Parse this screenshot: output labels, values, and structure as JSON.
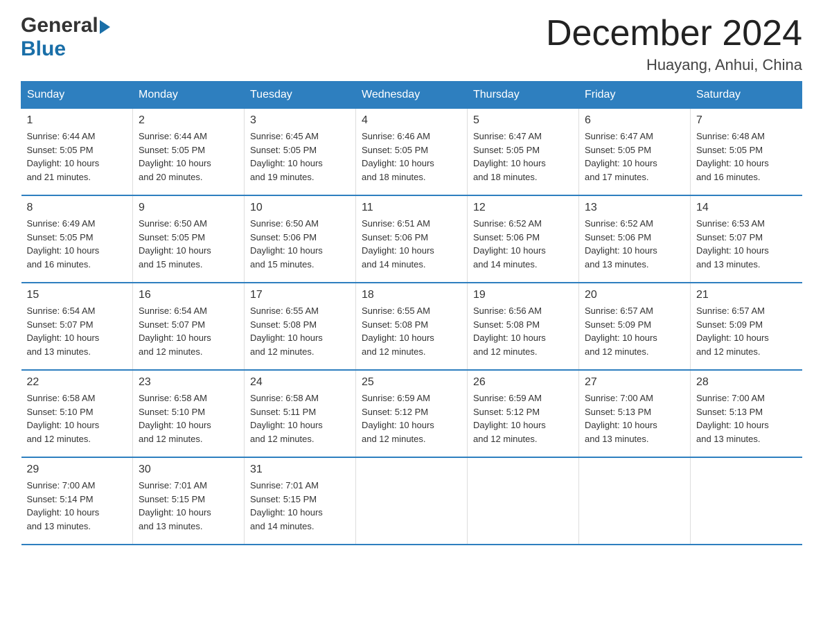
{
  "header": {
    "logo_general": "General",
    "logo_blue": "Blue",
    "month_title": "December 2024",
    "location": "Huayang, Anhui, China"
  },
  "weekdays": [
    "Sunday",
    "Monday",
    "Tuesday",
    "Wednesday",
    "Thursday",
    "Friday",
    "Saturday"
  ],
  "weeks": [
    [
      {
        "day": "1",
        "sunrise": "6:44 AM",
        "sunset": "5:05 PM",
        "daylight": "10 hours and 21 minutes."
      },
      {
        "day": "2",
        "sunrise": "6:44 AM",
        "sunset": "5:05 PM",
        "daylight": "10 hours and 20 minutes."
      },
      {
        "day": "3",
        "sunrise": "6:45 AM",
        "sunset": "5:05 PM",
        "daylight": "10 hours and 19 minutes."
      },
      {
        "day": "4",
        "sunrise": "6:46 AM",
        "sunset": "5:05 PM",
        "daylight": "10 hours and 18 minutes."
      },
      {
        "day": "5",
        "sunrise": "6:47 AM",
        "sunset": "5:05 PM",
        "daylight": "10 hours and 18 minutes."
      },
      {
        "day": "6",
        "sunrise": "6:47 AM",
        "sunset": "5:05 PM",
        "daylight": "10 hours and 17 minutes."
      },
      {
        "day": "7",
        "sunrise": "6:48 AM",
        "sunset": "5:05 PM",
        "daylight": "10 hours and 16 minutes."
      }
    ],
    [
      {
        "day": "8",
        "sunrise": "6:49 AM",
        "sunset": "5:05 PM",
        "daylight": "10 hours and 16 minutes."
      },
      {
        "day": "9",
        "sunrise": "6:50 AM",
        "sunset": "5:05 PM",
        "daylight": "10 hours and 15 minutes."
      },
      {
        "day": "10",
        "sunrise": "6:50 AM",
        "sunset": "5:06 PM",
        "daylight": "10 hours and 15 minutes."
      },
      {
        "day": "11",
        "sunrise": "6:51 AM",
        "sunset": "5:06 PM",
        "daylight": "10 hours and 14 minutes."
      },
      {
        "day": "12",
        "sunrise": "6:52 AM",
        "sunset": "5:06 PM",
        "daylight": "10 hours and 14 minutes."
      },
      {
        "day": "13",
        "sunrise": "6:52 AM",
        "sunset": "5:06 PM",
        "daylight": "10 hours and 13 minutes."
      },
      {
        "day": "14",
        "sunrise": "6:53 AM",
        "sunset": "5:07 PM",
        "daylight": "10 hours and 13 minutes."
      }
    ],
    [
      {
        "day": "15",
        "sunrise": "6:54 AM",
        "sunset": "5:07 PM",
        "daylight": "10 hours and 13 minutes."
      },
      {
        "day": "16",
        "sunrise": "6:54 AM",
        "sunset": "5:07 PM",
        "daylight": "10 hours and 12 minutes."
      },
      {
        "day": "17",
        "sunrise": "6:55 AM",
        "sunset": "5:08 PM",
        "daylight": "10 hours and 12 minutes."
      },
      {
        "day": "18",
        "sunrise": "6:55 AM",
        "sunset": "5:08 PM",
        "daylight": "10 hours and 12 minutes."
      },
      {
        "day": "19",
        "sunrise": "6:56 AM",
        "sunset": "5:08 PM",
        "daylight": "10 hours and 12 minutes."
      },
      {
        "day": "20",
        "sunrise": "6:57 AM",
        "sunset": "5:09 PM",
        "daylight": "10 hours and 12 minutes."
      },
      {
        "day": "21",
        "sunrise": "6:57 AM",
        "sunset": "5:09 PM",
        "daylight": "10 hours and 12 minutes."
      }
    ],
    [
      {
        "day": "22",
        "sunrise": "6:58 AM",
        "sunset": "5:10 PM",
        "daylight": "10 hours and 12 minutes."
      },
      {
        "day": "23",
        "sunrise": "6:58 AM",
        "sunset": "5:10 PM",
        "daylight": "10 hours and 12 minutes."
      },
      {
        "day": "24",
        "sunrise": "6:58 AM",
        "sunset": "5:11 PM",
        "daylight": "10 hours and 12 minutes."
      },
      {
        "day": "25",
        "sunrise": "6:59 AM",
        "sunset": "5:12 PM",
        "daylight": "10 hours and 12 minutes."
      },
      {
        "day": "26",
        "sunrise": "6:59 AM",
        "sunset": "5:12 PM",
        "daylight": "10 hours and 12 minutes."
      },
      {
        "day": "27",
        "sunrise": "7:00 AM",
        "sunset": "5:13 PM",
        "daylight": "10 hours and 13 minutes."
      },
      {
        "day": "28",
        "sunrise": "7:00 AM",
        "sunset": "5:13 PM",
        "daylight": "10 hours and 13 minutes."
      }
    ],
    [
      {
        "day": "29",
        "sunrise": "7:00 AM",
        "sunset": "5:14 PM",
        "daylight": "10 hours and 13 minutes."
      },
      {
        "day": "30",
        "sunrise": "7:01 AM",
        "sunset": "5:15 PM",
        "daylight": "10 hours and 13 minutes."
      },
      {
        "day": "31",
        "sunrise": "7:01 AM",
        "sunset": "5:15 PM",
        "daylight": "10 hours and 14 minutes."
      },
      null,
      null,
      null,
      null
    ]
  ],
  "labels": {
    "sunrise": "Sunrise:",
    "sunset": "Sunset:",
    "daylight": "Daylight:"
  }
}
